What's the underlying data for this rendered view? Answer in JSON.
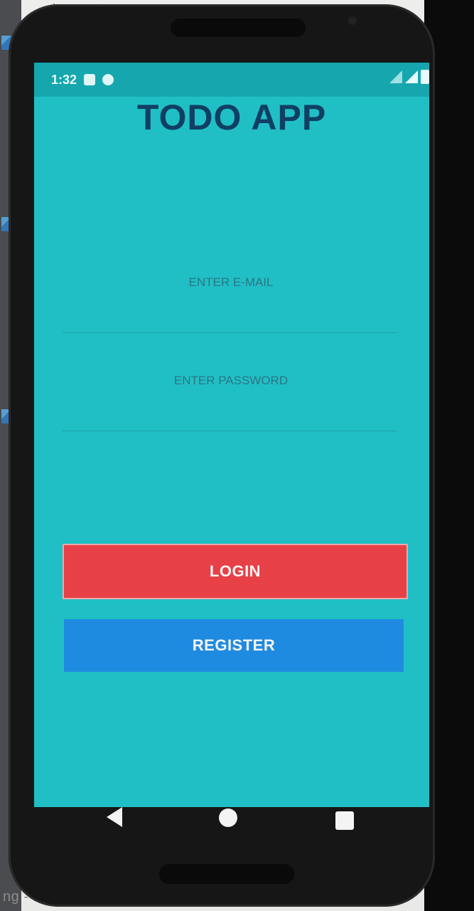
{
  "status_bar": {
    "time": "1:32"
  },
  "app": {
    "title": "TODO APP"
  },
  "form": {
    "email_placeholder": "ENTER E-MAIL",
    "password_placeholder": "ENTER PASSWORD",
    "login_label": "LOGIN",
    "register_label": "REGISTER"
  },
  "background": {
    "bottom_text": "ng - India's lar"
  },
  "colors": {
    "screen_bg": "#20bfc6",
    "status_bar_bg": "#16a7ae",
    "title": "#103f63",
    "login_button": "#e84047",
    "register_button": "#1f8be0"
  },
  "icons": {
    "nav": [
      "back-icon",
      "home-icon",
      "recent-apps-icon"
    ],
    "status": [
      "sd-card-icon",
      "sync-icon",
      "wifi-icon",
      "signal-icon",
      "battery-icon"
    ]
  }
}
